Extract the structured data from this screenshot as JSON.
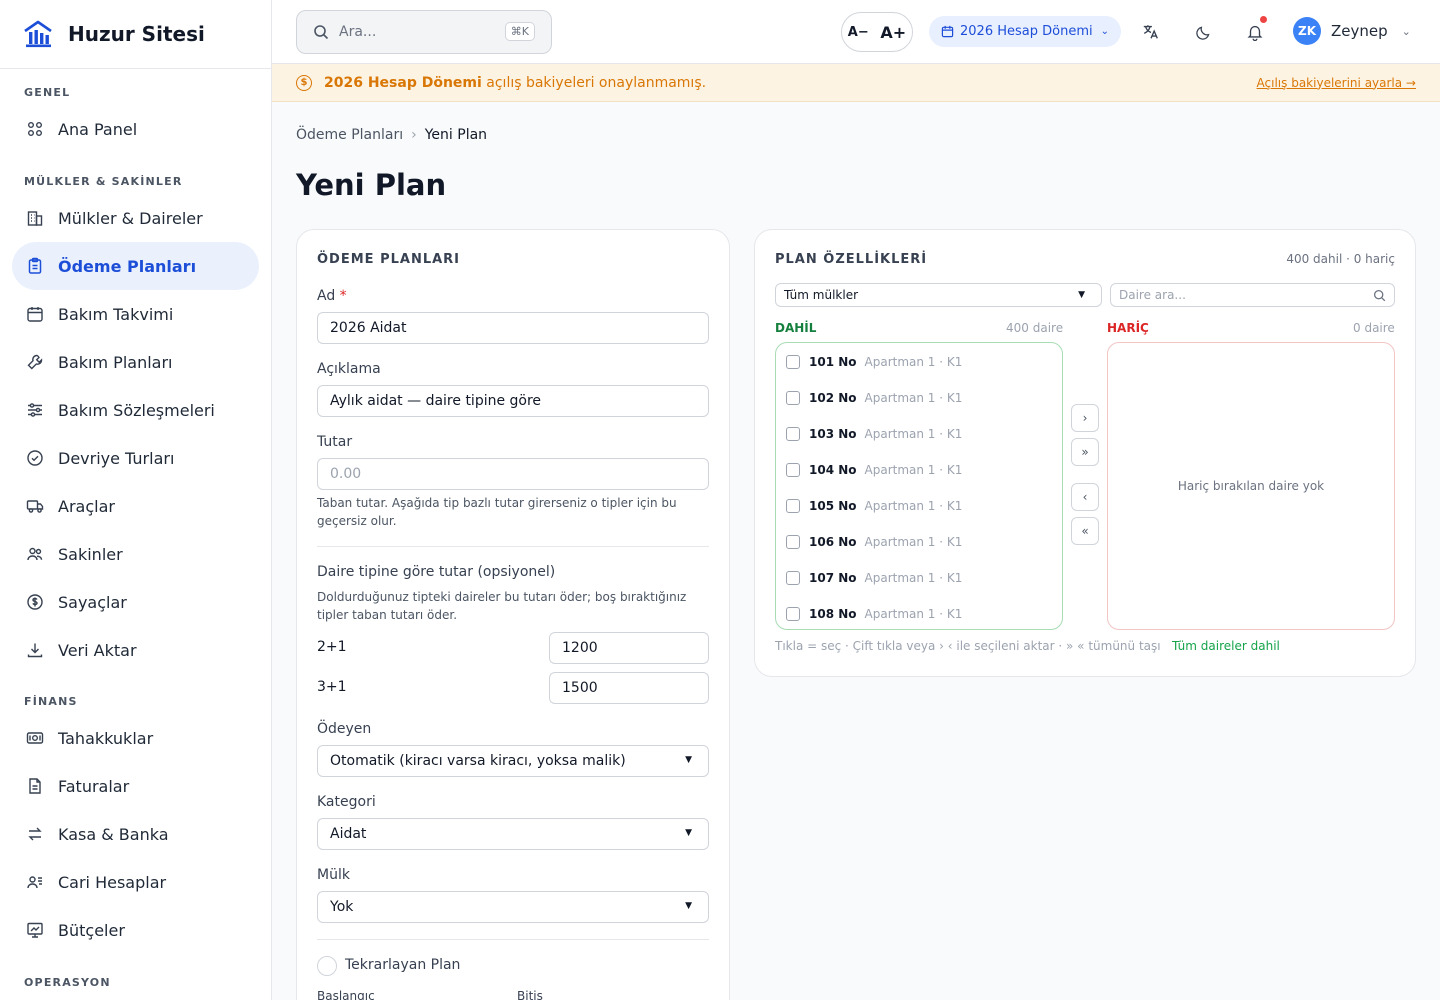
{
  "brand": {
    "name": "Huzur Sitesi"
  },
  "sidebar": {
    "sections": [
      {
        "title": "GENEL"
      },
      {
        "title": "MÜLKLER & SAKİNLER"
      },
      {
        "title": "FİNANS"
      },
      {
        "title": "OPERASYON"
      }
    ],
    "items": [
      {
        "label": "Ana Panel",
        "icon": "grid-icon"
      },
      {
        "label": "Mülkler & Daireler",
        "icon": "building-icon"
      },
      {
        "label": "Ödeme Planları",
        "icon": "clipboard-icon",
        "active": true
      },
      {
        "label": "Bakım Takvimi",
        "icon": "calendar-icon"
      },
      {
        "label": "Bakım Planları",
        "icon": "wrench-icon"
      },
      {
        "label": "Bakım Sözleşmeleri",
        "icon": "sliders-icon"
      },
      {
        "label": "Devriye Turları",
        "icon": "check-circle-icon"
      },
      {
        "label": "Araçlar",
        "icon": "truck-icon"
      },
      {
        "label": "Sakinler",
        "icon": "users-icon"
      },
      {
        "label": "Sayaçlar",
        "icon": "dollar-circle-icon"
      },
      {
        "label": "Veri Aktar",
        "icon": "download-icon"
      },
      {
        "label": "Tahakkuklar",
        "icon": "receipt-icon"
      },
      {
        "label": "Faturalar",
        "icon": "file-icon"
      },
      {
        "label": "Kasa & Banka",
        "icon": "transfer-icon"
      },
      {
        "label": "Cari Hesaplar",
        "icon": "contacts-icon"
      },
      {
        "label": "Bütçeler",
        "icon": "chart-icon"
      }
    ]
  },
  "header": {
    "search_placeholder": "Ara...",
    "search_shortcut": "⌘K",
    "font_decrease": "A−",
    "font_increase": "A+",
    "period": "2026 Hesap Dönemi",
    "user_initials": "ZK",
    "user_name": "Zeynep"
  },
  "banner": {
    "bold": "2026 Hesap Dönemi",
    "text": " açılış bakiyeleri onaylanmamış.",
    "link": "Açılış bakiyelerini ayarla →"
  },
  "breadcrumb": {
    "parent": "Ödeme Planları",
    "separator": "›",
    "current": "Yeni Plan"
  },
  "page_title": "Yeni Plan",
  "form": {
    "card_title": "ÖDEME PLANLARI",
    "name_label": "Ad",
    "name_required": "*",
    "name_value": "2026 Aidat",
    "desc_label": "Açıklama",
    "desc_value": "Aylık aidat — daire tipine göre",
    "amount_label": "Tutar",
    "amount_placeholder": "0.00",
    "amount_help": "Taban tutar. Aşağıda tip bazlı tutar girerseniz o tipler için bu geçersiz olur.",
    "type_title": "Daire tipine göre tutar (opsiyonel)",
    "type_help": "Doldurduğunuz tipteki daireler bu tutarı öder; boş bıraktığınız tipler taban tutarı öder.",
    "types": [
      {
        "label": "2+1",
        "value": "1200"
      },
      {
        "label": "3+1",
        "value": "1500"
      }
    ],
    "payer_label": "Ödeyen",
    "payer_value": "Otomatik (kiracı varsa kiracı, yoksa malik)",
    "category_label": "Kategori",
    "category_value": "Aidat",
    "property_label": "Mülk",
    "property_value": "Yok",
    "recurring_label": "Tekrarlayan Plan",
    "start_label": "Başlangıç",
    "end_label": "Bitiş"
  },
  "features": {
    "card_title": "PLAN ÖZELLİKLERİ",
    "summary": "400 dahil · 0 hariç",
    "filter_value": "Tüm mülkler",
    "search_placeholder": "Daire ara...",
    "included_title": "DAHİL",
    "included_count": "400 daire",
    "excluded_title": "HARİÇ",
    "excluded_count": "0 daire",
    "excluded_empty": "Hariç bırakılan daire yok",
    "units": [
      {
        "no": "101 No",
        "loc": "Apartman 1 · K1"
      },
      {
        "no": "102 No",
        "loc": "Apartman 1 · K1"
      },
      {
        "no": "103 No",
        "loc": "Apartman 1 · K1"
      },
      {
        "no": "104 No",
        "loc": "Apartman 1 · K1"
      },
      {
        "no": "105 No",
        "loc": "Apartman 1 · K1"
      },
      {
        "no": "106 No",
        "loc": "Apartman 1 · K1"
      },
      {
        "no": "107 No",
        "loc": "Apartman 1 · K1"
      },
      {
        "no": "108 No",
        "loc": "Apartman 1 · K1"
      }
    ],
    "btn_move_one": "›",
    "btn_move_all": "»",
    "btn_back_one": "‹",
    "btn_back_all": "«",
    "hint": "Tıkla = seç · Çift tıkla veya › ‹ ile seçileni aktar · » « tümünü taşı",
    "status": "Tüm daireler dahil"
  },
  "colors": {
    "accent": "#1d4ed8",
    "included": "#15803d",
    "excluded": "#dc2626",
    "warning": "#d97706"
  }
}
